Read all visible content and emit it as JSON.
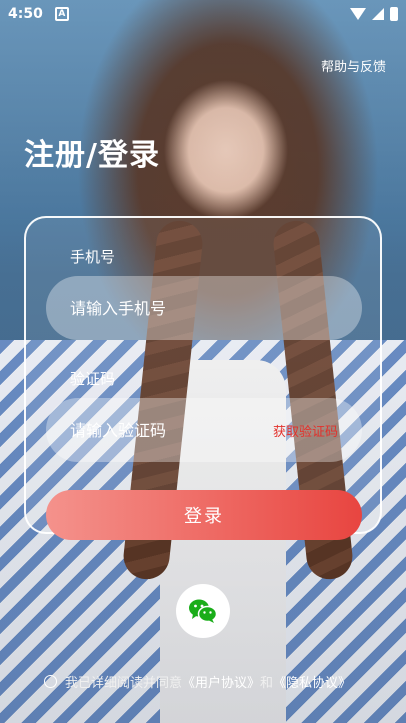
{
  "status_bar": {
    "time": "4:50",
    "notification_badge": "A"
  },
  "help_label": "帮助与反馈",
  "title": "注册/登录",
  "form": {
    "phone_label": "手机号",
    "phone_placeholder": "请输入手机号",
    "code_label": "验证码",
    "code_placeholder": "请输入验证码",
    "get_code_label": "获取验证码",
    "login_label": "登录"
  },
  "third_party": {
    "wechat_icon": "wechat-icon",
    "wechat_color": "#1aad19"
  },
  "agreement": {
    "prefix": "我已详细阅读并同意",
    "user_agreement": "《用户协议》",
    "and": "和",
    "privacy_agreement": "《隐私协议》"
  },
  "colors": {
    "accent": "#e84540",
    "get_code": "#e3312c"
  }
}
